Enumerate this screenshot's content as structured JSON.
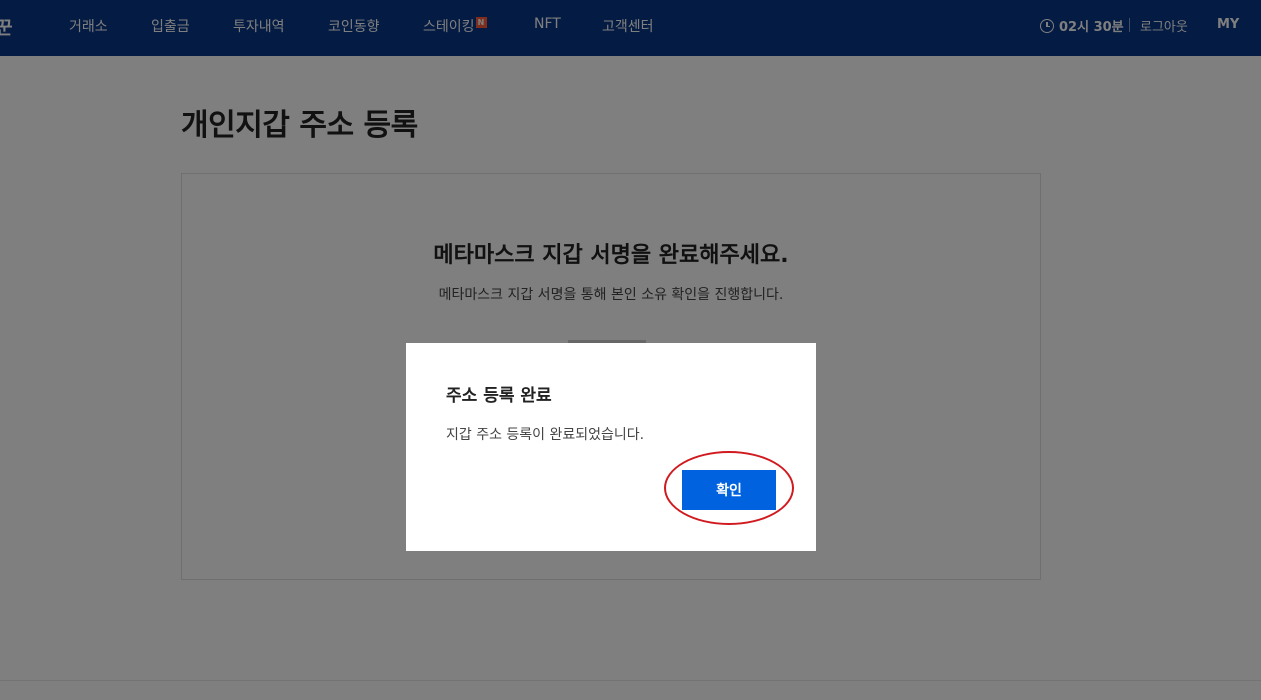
{
  "header": {
    "logo_fragment": "꾼",
    "nav": [
      {
        "label": "거래소"
      },
      {
        "label": "입출금"
      },
      {
        "label": "투자내역"
      },
      {
        "label": "코인동향"
      },
      {
        "label": "스테이킹",
        "badge": "N"
      },
      {
        "label": "NFT"
      },
      {
        "label": "고객센터"
      }
    ],
    "session_time": "02시 30분",
    "logout": "로그아웃",
    "my": "MY"
  },
  "page": {
    "title": "개인지갑 주소 등록",
    "card_heading": "메타마스크 지갑 서명을 완료해주세요.",
    "card_desc": "메타마스크 지갑 서명을 통해 본인 소유 확인을 진행합니다."
  },
  "modal": {
    "title": "주소 등록 완료",
    "message": "지갑 주소 등록이 완료되었습니다.",
    "confirm_label": "확인"
  },
  "colors": {
    "header_bg": "#093687",
    "primary_button": "#0062df",
    "highlight_ring": "#d01a1f",
    "badge": "#ff5d3a"
  }
}
